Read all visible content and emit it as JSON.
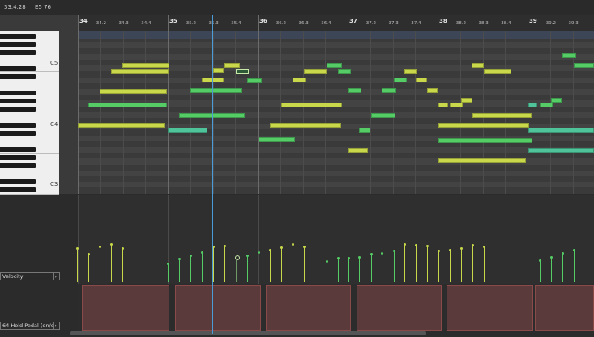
{
  "topbar": {
    "position": "33.4.28",
    "note_info": "E5  76"
  },
  "ruler": {
    "bars": [
      "34",
      "35",
      "36",
      "37",
      "38",
      "39"
    ],
    "beats": [
      [
        "34.2",
        "34.3",
        "34.4"
      ],
      [
        "35.2",
        "35.3",
        "35.4"
      ],
      [
        "36.2",
        "36.3",
        "36.4"
      ],
      [
        "37.2",
        "37.3",
        "37.4"
      ],
      [
        "38.2",
        "38.3",
        "38.4"
      ],
      [
        "39.2",
        "39.3"
      ]
    ]
  },
  "piano": {
    "labels": [
      "C5",
      "C4",
      "C3"
    ]
  },
  "lanes": {
    "velocity_label": "Velocity",
    "cc_label": "64 Hold Pedal (on/c"
  },
  "colors": {
    "note_yellow": "#c8d84a",
    "note_green": "#55cc66",
    "note_teal": "#4fc49a",
    "playhead": "#4a9bd6",
    "cc_fill": "#5a3a3a"
  }
}
